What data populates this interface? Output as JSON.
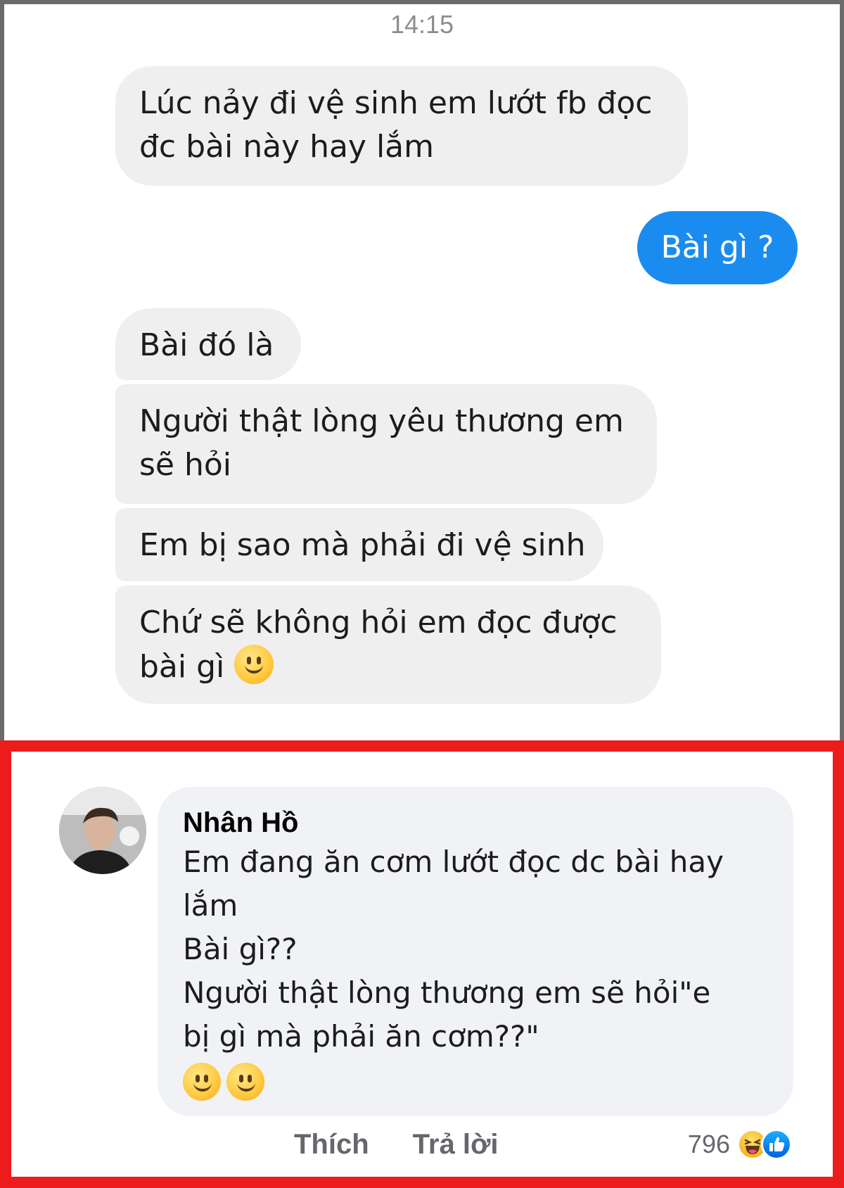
{
  "chat": {
    "timestamp": "14:15",
    "messages": [
      {
        "direction": "received",
        "lines": [
          "Lúc nảy đi vệ sinh em lướt fb đọc",
          "đc bài này hay lắm"
        ]
      },
      {
        "direction": "sent",
        "lines": [
          "Bài gì ?"
        ]
      },
      {
        "direction": "received",
        "lines": [
          "Bài đó là"
        ]
      },
      {
        "direction": "received",
        "lines": [
          "Người thật lòng yêu thương em",
          "sẽ hỏi"
        ]
      },
      {
        "direction": "received",
        "lines": [
          "Em bị sao mà phải đi vệ sinh"
        ]
      },
      {
        "direction": "received",
        "lines": [
          "Chứ sẽ không hỏi em đọc được",
          "bài gì"
        ],
        "trailing_emoji": "slightly-smiling-face"
      }
    ],
    "colors": {
      "received_bubble": "#efefef",
      "sent_bubble": "#1a8cf0"
    }
  },
  "comment": {
    "author": "Nhân Hồ",
    "lines": [
      "Em đang ăn cơm lướt đọc dc bài hay",
      "lắm",
      "Bài gì??",
      "Người thật lòng thương em sẽ hỏi\"e",
      "bị gì mà phải ăn cơm??\""
    ],
    "trailing_emojis": [
      "slightly-smiling-face",
      "slightly-smiling-face"
    ],
    "actions": {
      "like": "Thích",
      "reply": "Trả lời"
    },
    "reaction_count": "796",
    "reaction_icons": [
      "haha-reaction-icon",
      "like-reaction-icon"
    ],
    "highlight_color": "#ec1c1c"
  }
}
